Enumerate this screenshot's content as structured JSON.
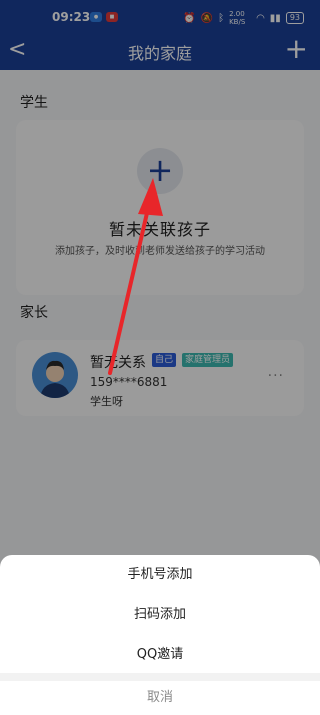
{
  "status_bar": {
    "time": "09:23",
    "net_speed": "2.00 KB/S",
    "battery": "93",
    "icons": [
      "alarm-icon",
      "mute-icon",
      "bluetooth-icon",
      "wifi-icon",
      "signal-icon"
    ]
  },
  "navbar": {
    "title": "我的家庭",
    "back_icon": "<",
    "add_icon": "+"
  },
  "students": {
    "section_title": "学生",
    "add_icon": "+",
    "empty_title": "暂未关联孩子",
    "empty_desc": "添加孩子，及时收到老师发送给孩子的学习活动"
  },
  "parents": {
    "section_title": "家长",
    "name": "暂无关系",
    "tag_self": "自己",
    "tag_admin": "家庭管理员",
    "phone": "159****6881",
    "role": "学生呀",
    "more": "···"
  },
  "action_sheet": {
    "items": [
      "手机号添加",
      "扫码添加",
      "QQ邀请"
    ],
    "cancel": "取消"
  },
  "colors": {
    "brand": "#1b3f96",
    "tag_self": "#2a5bd7",
    "tag_admin": "#3cb8b0",
    "arrow": "#e8262a"
  }
}
